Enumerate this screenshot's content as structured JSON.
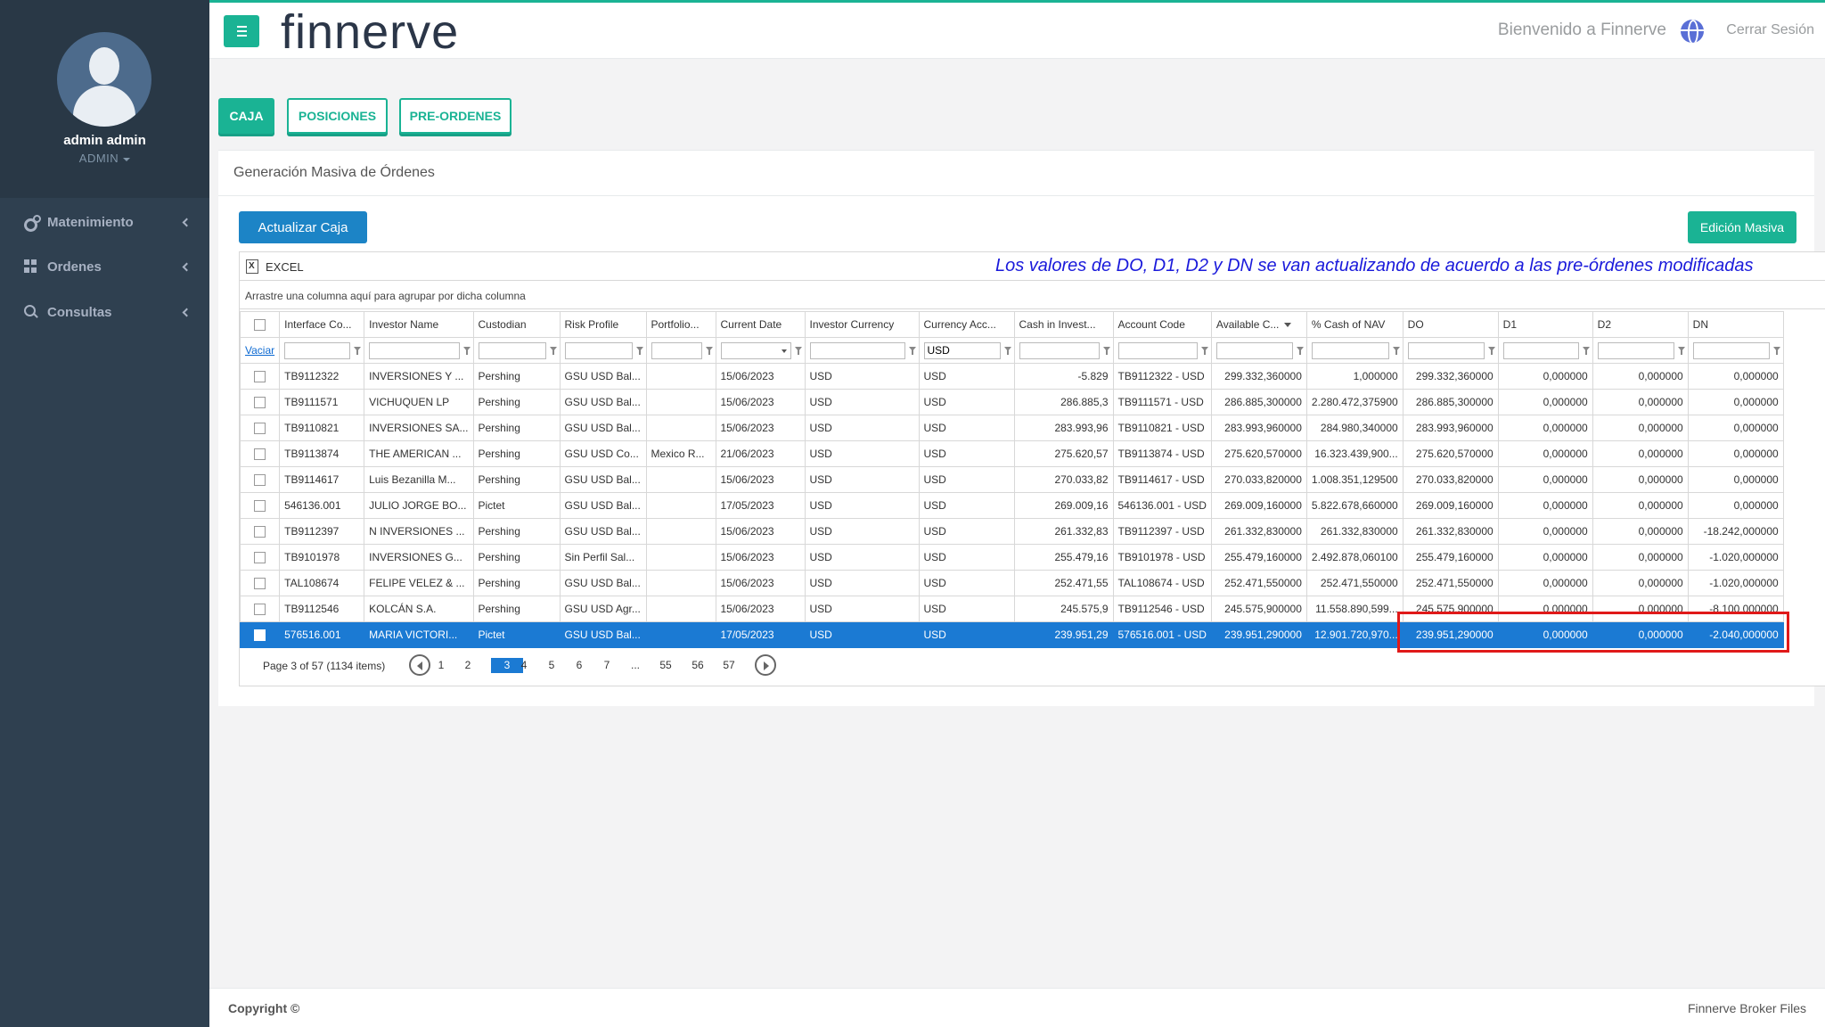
{
  "user": {
    "name": "admin admin",
    "role": "ADMIN"
  },
  "sidebar": {
    "items": [
      {
        "label": "Matenimiento",
        "icon": "gears-icon"
      },
      {
        "label": "Ordenes",
        "icon": "grid-icon"
      },
      {
        "label": "Consultas",
        "icon": "search-icon"
      }
    ]
  },
  "header": {
    "brand": "finnerve",
    "welcome": "Bienvenido a Finnerve",
    "logout": "Cerrar Sesión"
  },
  "tabs": [
    {
      "label": "CAJA",
      "active": true
    },
    {
      "label": "POSICIONES",
      "active": false
    },
    {
      "label": "PRE-ORDENES",
      "active": false
    }
  ],
  "panel": {
    "title": "Generación Masiva de Órdenes",
    "refresh_button": "Actualizar Caja",
    "bulk_edit_button": "Edición Masiva"
  },
  "grid": {
    "export_label": "EXCEL",
    "annotation": "Los valores de DO, D1, D2 y DN se van actualizando de acuerdo a las pre-órdenes modificadas",
    "group_hint": "Arrastre una columna aquí para agrupar por dicha columna",
    "clear_filters": "Vaciar",
    "columns": [
      "Interface Co...",
      "Investor Name",
      "Custodian",
      "Risk Profile",
      "Portfolio...",
      "Current Date",
      "Investor Currency",
      "Currency Acc...",
      "Cash in Invest...",
      "Account Code",
      "Available C...",
      "% Cash of NAV",
      "DO",
      "D1",
      "D2",
      "DN"
    ],
    "currency_filter": "USD",
    "rows": [
      [
        "TB9112322",
        "INVERSIONES Y ...",
        "Pershing",
        "GSU USD Bal...",
        "",
        "15/06/2023",
        "USD",
        "USD",
        "-5.829",
        "TB9112322 - USD",
        "299.332,360000",
        "1,000000",
        "299.332,360000",
        "0,000000",
        "0,000000",
        "0,000000"
      ],
      [
        "TB9111571",
        "VICHUQUEN LP",
        "Pershing",
        "GSU USD Bal...",
        "",
        "15/06/2023",
        "USD",
        "USD",
        "286.885,3",
        "TB9111571 - USD",
        "286.885,300000",
        "2.280.472,375900",
        "286.885,300000",
        "0,000000",
        "0,000000",
        "0,000000"
      ],
      [
        "TB9110821",
        "INVERSIONES SA...",
        "Pershing",
        "GSU USD Bal...",
        "",
        "15/06/2023",
        "USD",
        "USD",
        "283.993,96",
        "TB9110821 - USD",
        "283.993,960000",
        "284.980,340000",
        "283.993,960000",
        "0,000000",
        "0,000000",
        "0,000000"
      ],
      [
        "TB9113874",
        "THE AMERICAN ...",
        "Pershing",
        "GSU USD Co...",
        "Mexico R...",
        "21/06/2023",
        "USD",
        "USD",
        "275.620,57",
        "TB9113874 - USD",
        "275.620,570000",
        "16.323.439,900...",
        "275.620,570000",
        "0,000000",
        "0,000000",
        "0,000000"
      ],
      [
        "TB9114617",
        "Luis Bezanilla M...",
        "Pershing",
        "GSU USD Bal...",
        "",
        "15/06/2023",
        "USD",
        "USD",
        "270.033,82",
        "TB9114617 - USD",
        "270.033,820000",
        "1.008.351,129500",
        "270.033,820000",
        "0,000000",
        "0,000000",
        "0,000000"
      ],
      [
        "546136.001",
        "JULIO JORGE BO...",
        "Pictet",
        "GSU USD Bal...",
        "",
        "17/05/2023",
        "USD",
        "USD",
        "269.009,16",
        "546136.001 - USD",
        "269.009,160000",
        "5.822.678,660000",
        "269.009,160000",
        "0,000000",
        "0,000000",
        "0,000000"
      ],
      [
        "TB9112397",
        "N INVERSIONES ...",
        "Pershing",
        "GSU USD Bal...",
        "",
        "15/06/2023",
        "USD",
        "USD",
        "261.332,83",
        "TB9112397 - USD",
        "261.332,830000",
        "261.332,830000",
        "261.332,830000",
        "0,000000",
        "0,000000",
        "-18.242,000000"
      ],
      [
        "TB9101978",
        "INVERSIONES G...",
        "Pershing",
        "Sin Perfil Sal...",
        "",
        "15/06/2023",
        "USD",
        "USD",
        "255.479,16",
        "TB9101978 - USD",
        "255.479,160000",
        "2.492.878,060100",
        "255.479,160000",
        "0,000000",
        "0,000000",
        "-1.020,000000"
      ],
      [
        "TAL108674",
        "FELIPE VELEZ & ...",
        "Pershing",
        "GSU USD Bal...",
        "",
        "15/06/2023",
        "USD",
        "USD",
        "252.471,55",
        "TAL108674 - USD",
        "252.471,550000",
        "252.471,550000",
        "252.471,550000",
        "0,000000",
        "0,000000",
        "-1.020,000000"
      ],
      [
        "TB9112546",
        "KOLCÁN S.A.",
        "Pershing",
        "GSU USD Agr...",
        "",
        "15/06/2023",
        "USD",
        "USD",
        "245.575,9",
        "TB9112546 - USD",
        "245.575,900000",
        "11.558.890,599...",
        "245.575,900000",
        "0,000000",
        "0,000000",
        "-8.100,000000"
      ],
      [
        "576516.001",
        "MARIA VICTORI...",
        "Pictet",
        "GSU USD Bal...",
        "",
        "17/05/2023",
        "USD",
        "USD",
        "239.951,29",
        "576516.001 - USD",
        "239.951,290000",
        "12.901.720,970...",
        "239.951,290000",
        "0,000000",
        "0,000000",
        "-2.040,000000"
      ]
    ],
    "selected_row": 10,
    "pager": {
      "info": "Page 3 of 57 (1134 items)",
      "pages": [
        "1",
        "2",
        "3",
        "4",
        "5",
        "6",
        "7",
        "...",
        "55",
        "56",
        "57"
      ],
      "current": "3"
    }
  },
  "footer": {
    "left": "Copyright ©",
    "right": "Finnerve Broker Files"
  },
  "colors": {
    "accent": "#1ab394",
    "primary": "#1c84c6",
    "selection": "#1b7ad3",
    "sidebar": "#2f4050",
    "highlight": "#e01919"
  }
}
